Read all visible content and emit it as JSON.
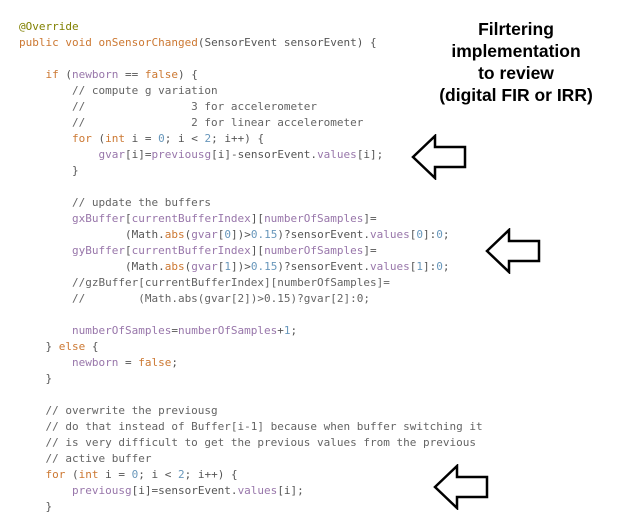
{
  "annotation": {
    "lines": [
      "Filrtering",
      "implementation",
      "to review",
      "(digital FIR or IRR)"
    ]
  },
  "code": {
    "lines": [
      [
        {
          "c": "t-ann",
          "t": "@Override"
        }
      ],
      [
        {
          "c": "t-kw",
          "t": "public void "
        },
        {
          "c": "t-fn",
          "t": "onSensorChanged"
        },
        {
          "c": "t-plain",
          "t": "(SensorEvent sensorEvent) {"
        }
      ],
      [],
      [
        {
          "c": "t-plain",
          "t": "    "
        },
        {
          "c": "t-kw",
          "t": "if "
        },
        {
          "c": "t-plain",
          "t": "("
        },
        {
          "c": "t-var",
          "t": "newborn"
        },
        {
          "c": "t-plain",
          "t": " == "
        },
        {
          "c": "t-kw",
          "t": "false"
        },
        {
          "c": "t-plain",
          "t": ") {"
        }
      ],
      [
        {
          "c": "t-cmt",
          "t": "        // compute g variation"
        }
      ],
      [
        {
          "c": "t-cmt",
          "t": "        //                3 for accelerometer"
        }
      ],
      [
        {
          "c": "t-cmt",
          "t": "        //                2 for linear accelerometer"
        }
      ],
      [
        {
          "c": "t-plain",
          "t": "        "
        },
        {
          "c": "t-kw",
          "t": "for "
        },
        {
          "c": "t-plain",
          "t": "("
        },
        {
          "c": "t-kw",
          "t": "int "
        },
        {
          "c": "t-plain",
          "t": "i = "
        },
        {
          "c": "t-num",
          "t": "0"
        },
        {
          "c": "t-plain",
          "t": "; i < "
        },
        {
          "c": "t-num",
          "t": "2"
        },
        {
          "c": "t-plain",
          "t": "; i++) {"
        }
      ],
      [
        {
          "c": "t-plain",
          "t": "            "
        },
        {
          "c": "t-var",
          "t": "gvar"
        },
        {
          "c": "t-plain",
          "t": "[i]="
        },
        {
          "c": "t-var",
          "t": "previousg"
        },
        {
          "c": "t-plain",
          "t": "[i]-sensorEvent."
        },
        {
          "c": "t-var",
          "t": "values"
        },
        {
          "c": "t-plain",
          "t": "[i];"
        }
      ],
      [
        {
          "c": "t-plain",
          "t": "        }"
        }
      ],
      [],
      [
        {
          "c": "t-cmt",
          "t": "        // update the buffers"
        }
      ],
      [
        {
          "c": "t-plain",
          "t": "        "
        },
        {
          "c": "t-var",
          "t": "gxBuffer"
        },
        {
          "c": "t-plain",
          "t": "["
        },
        {
          "c": "t-var",
          "t": "currentBufferIndex"
        },
        {
          "c": "t-plain",
          "t": "]["
        },
        {
          "c": "t-var",
          "t": "numberOfSamples"
        },
        {
          "c": "t-plain",
          "t": "]="
        }
      ],
      [
        {
          "c": "t-plain",
          "t": "                (Math."
        },
        {
          "c": "t-fn",
          "t": "abs"
        },
        {
          "c": "t-plain",
          "t": "("
        },
        {
          "c": "t-var",
          "t": "gvar"
        },
        {
          "c": "t-plain",
          "t": "["
        },
        {
          "c": "t-num",
          "t": "0"
        },
        {
          "c": "t-plain",
          "t": "])>"
        },
        {
          "c": "t-num",
          "t": "0.15"
        },
        {
          "c": "t-plain",
          "t": ")?sensorEvent."
        },
        {
          "c": "t-var",
          "t": "values"
        },
        {
          "c": "t-plain",
          "t": "["
        },
        {
          "c": "t-num",
          "t": "0"
        },
        {
          "c": "t-plain",
          "t": "]:"
        },
        {
          "c": "t-num",
          "t": "0"
        },
        {
          "c": "t-plain",
          "t": ";"
        }
      ],
      [
        {
          "c": "t-plain",
          "t": "        "
        },
        {
          "c": "t-var",
          "t": "gyBuffer"
        },
        {
          "c": "t-plain",
          "t": "["
        },
        {
          "c": "t-var",
          "t": "currentBufferIndex"
        },
        {
          "c": "t-plain",
          "t": "]["
        },
        {
          "c": "t-var",
          "t": "numberOfSamples"
        },
        {
          "c": "t-plain",
          "t": "]="
        }
      ],
      [
        {
          "c": "t-plain",
          "t": "                (Math."
        },
        {
          "c": "t-fn",
          "t": "abs"
        },
        {
          "c": "t-plain",
          "t": "("
        },
        {
          "c": "t-var",
          "t": "gvar"
        },
        {
          "c": "t-plain",
          "t": "["
        },
        {
          "c": "t-num",
          "t": "1"
        },
        {
          "c": "t-plain",
          "t": "])>"
        },
        {
          "c": "t-num",
          "t": "0.15"
        },
        {
          "c": "t-plain",
          "t": ")?sensorEvent."
        },
        {
          "c": "t-var",
          "t": "values"
        },
        {
          "c": "t-plain",
          "t": "["
        },
        {
          "c": "t-num",
          "t": "1"
        },
        {
          "c": "t-plain",
          "t": "]:"
        },
        {
          "c": "t-num",
          "t": "0"
        },
        {
          "c": "t-plain",
          "t": ";"
        }
      ],
      [
        {
          "c": "t-cmt",
          "t": "        //gzBuffer[currentBufferIndex][numberOfSamples]="
        }
      ],
      [
        {
          "c": "t-cmt",
          "t": "        //        (Math.abs(gvar[2])>0.15)?gvar[2]:0;"
        }
      ],
      [],
      [
        {
          "c": "t-plain",
          "t": "        "
        },
        {
          "c": "t-var",
          "t": "numberOfSamples"
        },
        {
          "c": "t-plain",
          "t": "="
        },
        {
          "c": "t-var",
          "t": "numberOfSamples"
        },
        {
          "c": "t-plain",
          "t": "+"
        },
        {
          "c": "t-num",
          "t": "1"
        },
        {
          "c": "t-plain",
          "t": ";"
        }
      ],
      [
        {
          "c": "t-plain",
          "t": "    } "
        },
        {
          "c": "t-kw",
          "t": "else "
        },
        {
          "c": "t-plain",
          "t": "{"
        }
      ],
      [
        {
          "c": "t-plain",
          "t": "        "
        },
        {
          "c": "t-var",
          "t": "newborn"
        },
        {
          "c": "t-plain",
          "t": " = "
        },
        {
          "c": "t-kw",
          "t": "false"
        },
        {
          "c": "t-plain",
          "t": ";"
        }
      ],
      [
        {
          "c": "t-plain",
          "t": "    }"
        }
      ],
      [],
      [
        {
          "c": "t-cmt",
          "t": "    // overwrite the previousg"
        }
      ],
      [
        {
          "c": "t-cmt",
          "t": "    // do that instead of Buffer[i-1] because when buffer switching it"
        }
      ],
      [
        {
          "c": "t-cmt",
          "t": "    // is very difficult to get the previous values from the previous"
        }
      ],
      [
        {
          "c": "t-cmt",
          "t": "    // active buffer"
        }
      ],
      [
        {
          "c": "t-plain",
          "t": "    "
        },
        {
          "c": "t-kw",
          "t": "for "
        },
        {
          "c": "t-plain",
          "t": "("
        },
        {
          "c": "t-kw",
          "t": "int "
        },
        {
          "c": "t-plain",
          "t": "i = "
        },
        {
          "c": "t-num",
          "t": "0"
        },
        {
          "c": "t-plain",
          "t": "; i < "
        },
        {
          "c": "t-num",
          "t": "2"
        },
        {
          "c": "t-plain",
          "t": "; i++) {"
        }
      ],
      [
        {
          "c": "t-plain",
          "t": "        "
        },
        {
          "c": "t-var",
          "t": "previousg"
        },
        {
          "c": "t-plain",
          "t": "[i]=sensorEvent."
        },
        {
          "c": "t-var",
          "t": "values"
        },
        {
          "c": "t-plain",
          "t": "[i];"
        }
      ],
      [
        {
          "c": "t-plain",
          "t": "    }"
        }
      ]
    ]
  },
  "icons": {
    "arrows": [
      "left-arrow-icon",
      "left-arrow-icon",
      "left-arrow-icon"
    ]
  }
}
